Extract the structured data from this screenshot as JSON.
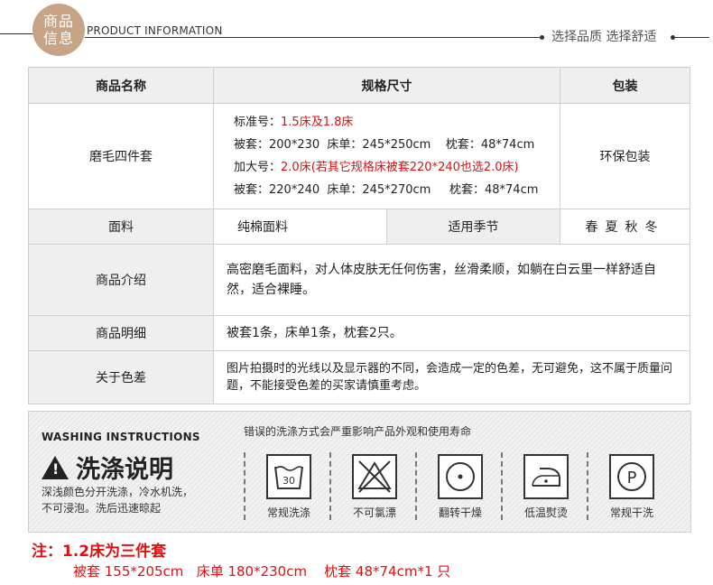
{
  "header": {
    "badge_line1": "商品",
    "badge_line2": "信息",
    "title": "PRODUCT INFORMATION",
    "slogan": "选择品质  选择舒适"
  },
  "table": {
    "headers": [
      "商品名称",
      "规格尺寸",
      "包装"
    ],
    "product": {
      "name": "磨毛四件套",
      "std_label": "标准号：",
      "std_value": "1.5床及1.8床",
      "std_dims": "被套：200*230  床单：245*250cm    枕套：48*74cm",
      "large_label": "加大号：",
      "large_value": "2.0床(若其它规格床被套220*240也选2.0床)",
      "large_dims": "被套：220*240  床单：245*270cm     枕套：48*74cm",
      "packaging": "环保包装"
    },
    "fabric": {
      "label": "面料",
      "value": "纯棉面料",
      "season_label": "适用季节",
      "season_value": "春夏秋冬"
    },
    "intro": {
      "label": "商品介绍",
      "value": "高密磨毛面料，对人体皮肤无任何伤害，丝滑柔顺，如躺在白云里一样舒适自然，适合裸睡。"
    },
    "details": {
      "label": "商品明细",
      "value": "被套1条，床单1条，枕套2只。"
    },
    "color": {
      "label": "关于色差",
      "value": "图片拍摄时的光线以及显示器的不同，会造成一定的色差，无可避免，这不属于质量问题，不能接受色差的买家请慎重考虑。"
    }
  },
  "washing": {
    "title_en": "WASHING  INSTRUCTIONS",
    "title_cn": "洗涤说明",
    "warn_symbol": "!",
    "desc_line1": "深浅颜色分开洗涤，冷水机洗，",
    "desc_line2": "不可浸泡。洗后迅速晾起",
    "note": "错误的洗涤方式会严重影响产品外观和使用寿命",
    "icons": [
      {
        "icon": "wash-30-icon",
        "label": "常规洗涤",
        "text": "30"
      },
      {
        "icon": "no-bleach-icon",
        "label": "不可氯漂"
      },
      {
        "icon": "tumble-dry-icon",
        "label": "翻转干燥"
      },
      {
        "icon": "low-iron-icon",
        "label": "低温熨烫"
      },
      {
        "icon": "dry-clean-icon",
        "label": "常规干洗",
        "text": "P"
      }
    ]
  },
  "note": {
    "title": "注：1.2床为三件套",
    "dims": "被套 155*205cm   床单 180*230cm    枕套 48*74cm*1 只"
  },
  "colors": {
    "badge": "#c7a485",
    "red": "#d21414",
    "label_bg": "#efefef"
  }
}
